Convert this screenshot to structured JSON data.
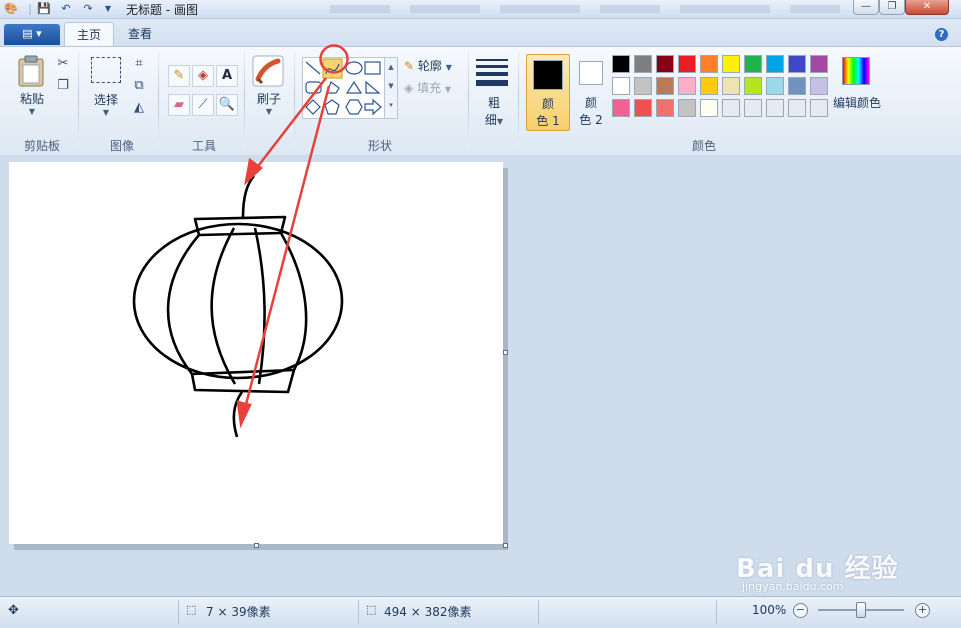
{
  "window": {
    "title": "无标题 - 画图"
  },
  "tabs": {
    "home": "主页",
    "view": "查看"
  },
  "ribbon": {
    "clipboard": {
      "paste": "粘贴",
      "group": "剪贴板"
    },
    "image": {
      "select": "选择",
      "group": "图像"
    },
    "tools": {
      "group": "工具",
      "text_tool_glyph": "A"
    },
    "brushes": {
      "label": "刷子"
    },
    "shapes": {
      "outline": "轮廓",
      "fill": "填充",
      "group": "形状"
    },
    "size": {
      "label_top": "粗",
      "label_bottom": "细"
    },
    "colors": {
      "color1_top": "颜",
      "color1_bottom": "色 1",
      "color2_top": "颜",
      "color2_bottom": "色 2",
      "edit": "编辑颜色",
      "group": "颜色",
      "color1_value": "#000000",
      "color2_value": "#ffffff",
      "palette": [
        [
          "#000000",
          "#7f7f7f",
          "#880015",
          "#ed1c24",
          "#ff7f27",
          "#fff200",
          "#22b14c",
          "#00a2e8",
          "#3f48cc",
          "#a349a4"
        ],
        [
          "#ffffff",
          "#c3c3c3",
          "#b97a57",
          "#ffaec9",
          "#ffc90e",
          "#efe4b0",
          "#b5e61d",
          "#99d9ea",
          "#7092be",
          "#c8bfe7"
        ],
        [
          "#f06292",
          "#f0504e",
          "#f07070",
          "#c3c3c3",
          "#fffff0",
          "#e6ebf2",
          "#e6ebf2",
          "#e6ebf2",
          "#e6ebf2",
          "#e6ebf2"
        ]
      ]
    }
  },
  "status": {
    "cursor_pos": "7 × 39像素",
    "canvas_size": "494 × 382像素",
    "zoom": "100%"
  },
  "watermark": {
    "logo": "Bai du 经验",
    "url": "jingyan.baidu.com"
  },
  "annotation_color": "#e8413c"
}
